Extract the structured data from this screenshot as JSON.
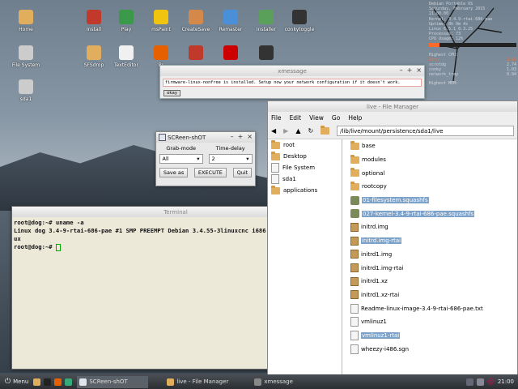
{
  "desktop": {
    "icons": [
      {
        "label": "Home",
        "color": "#e0ae5c",
        "icon": "folder-home-icon"
      },
      {
        "label": "Install",
        "color": "#c0392b",
        "icon": "install-icon"
      },
      {
        "label": "Play",
        "color": "#3a9a4a",
        "icon": "play-icon"
      },
      {
        "label": "msPaint",
        "color": "#f1c40f",
        "icon": "paint-icon"
      },
      {
        "label": "CreateSave",
        "color": "#d4894a",
        "icon": "save-icon"
      },
      {
        "label": "Remaster",
        "color": "#4a90d9",
        "icon": "remaster-icon"
      },
      {
        "label": "Installer",
        "color": "#5aa05a",
        "icon": "installer-icon"
      },
      {
        "label": "conkytoggle",
        "color": "#333333",
        "icon": "conky-icon"
      },
      {
        "label": "File System",
        "color": "#cccccc",
        "icon": "drive-icon"
      },
      {
        "label": "SFSdrop",
        "color": "#e0ae5c",
        "icon": "sfsdrop-icon"
      },
      {
        "label": "TextEditor",
        "color": "#f0f0f0",
        "icon": "text-editor-icon"
      },
      {
        "label": "Br",
        "color": "#e66000",
        "icon": "browser-icon"
      },
      {
        "label": "",
        "color": "#c0392b",
        "icon": "debian-icon"
      },
      {
        "label": "",
        "color": "#cc0000",
        "icon": "youtube-icon"
      },
      {
        "label": "",
        "color": "#333333",
        "icon": "app-icon"
      },
      {
        "label": "sda1",
        "color": "#cccccc",
        "icon": "drive-icon"
      }
    ]
  },
  "conky": {
    "title": "Debian Portable OS",
    "date": "Saturday, February 2015",
    "time": "21.00.00",
    "lines": [
      "Kernel: 3.4.9-rtai-686-pae",
      "Uptime: 0h 0m 4s",
      "Linux 6.5.1 0.3.25",
      "Processes: 73",
      "CPU Usage: 12%"
    ],
    "cpu_bar": 0.12,
    "cpu_header": "Highest CPU:",
    "cpu_procs": [
      [
        "Xorg",
        "3.42"
      ],
      [
        "scrotdg",
        "2.74"
      ],
      [
        "conky",
        "1.03"
      ],
      [
        "network_tray",
        "0.94"
      ]
    ],
    "mem_header": "Highest MEM:"
  },
  "xmessage": {
    "title": "xmessage",
    "text": "firmware-linux-nonfree is installed. Setup now your network configuration if it doesn't work.",
    "ok": "okay"
  },
  "screenshot_tool": {
    "title": "SCReen-shOT",
    "grab_label": "Grab-mode",
    "delay_label": "Time-delay",
    "grab_value": "All",
    "delay_value": "2",
    "save": "Save as",
    "execute": "EXECUTE",
    "quit": "Quit"
  },
  "terminal": {
    "title": "Terminal",
    "lines": [
      "root@dog:~# uname -a",
      "Linux dog 3.4-9-rtai-686-pae #1 SMP PREEMPT Debian 3.4.55-3linuxcnc i686 GNU/Lin",
      "ux",
      "root@dog:~# "
    ]
  },
  "file_manager": {
    "title": "live - File Manager",
    "menu": [
      "File",
      "Edit",
      "View",
      "Go",
      "Help"
    ],
    "path": "/lib/live/mount/persistence/sda1/live",
    "sidebar": [
      "root",
      "Desktop",
      "File System",
      "sda1",
      "applications"
    ],
    "files": [
      {
        "name": "base",
        "kind": "folder",
        "sel": false
      },
      {
        "name": "modules",
        "kind": "folder",
        "sel": false
      },
      {
        "name": "optional",
        "kind": "folder",
        "sel": false
      },
      {
        "name": "rootcopy",
        "kind": "folder",
        "sel": false
      },
      {
        "name": "01-filesystem.squashfs",
        "kind": "pkg",
        "sel": true
      },
      {
        "name": "027-kernel-3.4-9-rtai-686-pae.squashfs",
        "kind": "pkg",
        "sel": true
      },
      {
        "name": "initrd.img",
        "kind": "arc",
        "sel": false
      },
      {
        "name": "initrd.img-rtai",
        "kind": "arc",
        "sel": true
      },
      {
        "name": "initrd1.img",
        "kind": "arc",
        "sel": false
      },
      {
        "name": "initrd1.img-rtai",
        "kind": "arc",
        "sel": false
      },
      {
        "name": "initrd1.xz",
        "kind": "arc",
        "sel": false
      },
      {
        "name": "initrd1.xz-rtai",
        "kind": "arc",
        "sel": false
      },
      {
        "name": "Readme-linux-image-3.4-9-rtai-686-pae.txt",
        "kind": "file",
        "sel": false
      },
      {
        "name": "vmlinuz1",
        "kind": "file",
        "sel": false
      },
      {
        "name": "vmlinuz1-rtai",
        "kind": "file",
        "sel": true
      },
      {
        "name": "wheezy-i486.sgn",
        "kind": "file",
        "sel": false
      }
    ]
  },
  "taskbar": {
    "menu": "Menu",
    "tasks": [
      "SCReen-shOT",
      "live - File Manager",
      "xmessage"
    ],
    "clock": "21:00"
  }
}
